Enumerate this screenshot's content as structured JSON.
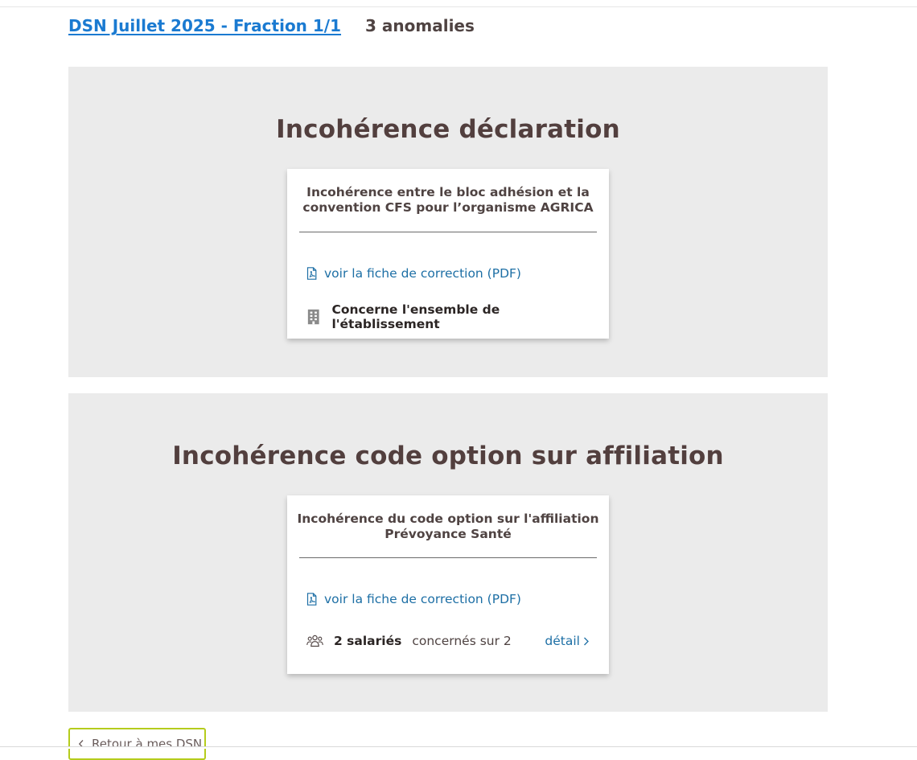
{
  "header": {
    "dsn_title": "DSN Juillet 2025 - Fraction 1/1",
    "anomalies_count": "3 anomalies"
  },
  "sections": [
    {
      "title": "Incohérence déclaration",
      "card": {
        "title": "Incohérence entre le bloc adhésion et la convention CFS pour l’organisme AGRICA",
        "pdf_link": "voir la fiche de correction (PDF)",
        "scope_text": "Concerne l'ensemble de l'établissement",
        "scope_icon": "building-icon"
      }
    },
    {
      "title": "Incohérence code option sur affiliation",
      "card": {
        "title": "Incohérence du code option sur l'affiliation Prévoyance Santé",
        "pdf_link": "voir la fiche de correction (PDF)",
        "employees_strong": "2 salariés",
        "employees_rest": "concernés sur 2",
        "employees_icon": "users-icon",
        "detail_link": "détail"
      }
    }
  ],
  "footer": {
    "back_label": "Retour à mes DSN"
  },
  "colors": {
    "link_blue": "#1a7ad1",
    "title_brown": "#523f3e",
    "section_bg": "#ebebeb",
    "back_border": "#b5cc1c"
  }
}
